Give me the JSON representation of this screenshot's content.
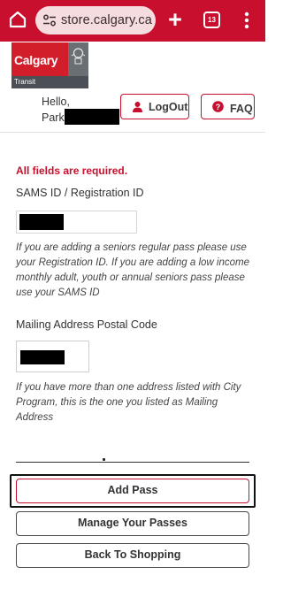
{
  "browser": {
    "url": "store.calgary.ca",
    "tab_count": "13"
  },
  "logo": {
    "name": "Calgary",
    "subtitle": "Transit"
  },
  "header": {
    "greeting_line1": "Hello,",
    "greeting_line2": "Park,",
    "logout_label": "LogOut",
    "faq_label": "FAQ"
  },
  "form": {
    "required_note": "All fields are required.",
    "sams_label": "SAMS ID / Registration ID",
    "sams_help": "If you are adding a seniors regular pass please use your Registration ID. If you are adding a low income monthly adult, youth or annual seniors pass please use your SAMS ID",
    "postal_label": "Mailing Address Postal Code",
    "postal_help": "If you have more than one address listed with City Program, this is the one you listed as Mailing Address"
  },
  "actions": {
    "add_pass": "Add Pass",
    "manage_passes": "Manage Your Passes",
    "back_to_shopping": "Back To Shopping"
  },
  "colors": {
    "brand_red": "#c8102e",
    "chrome_red": "#c8102e"
  }
}
